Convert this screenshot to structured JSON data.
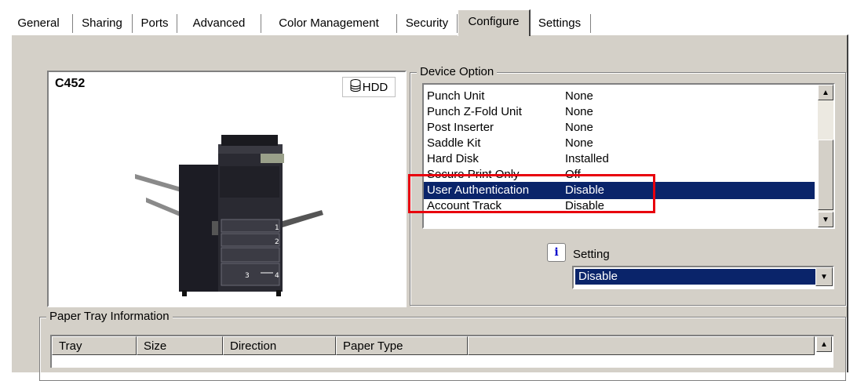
{
  "tabs": [
    {
      "label": "General"
    },
    {
      "label": "Sharing"
    },
    {
      "label": "Ports"
    },
    {
      "label": "Advanced"
    },
    {
      "label": "Color Management"
    },
    {
      "label": "Security"
    },
    {
      "label": "Configure"
    },
    {
      "label": "Settings"
    }
  ],
  "active_tab": "Configure",
  "preview": {
    "model": "C452",
    "hdd_label": "HDD",
    "tray_numbers": [
      "1",
      "2",
      "3",
      "4"
    ]
  },
  "device_option": {
    "title": "Device Option",
    "rows": [
      {
        "name": "Punch Unit",
        "value": "None"
      },
      {
        "name": "Punch Z-Fold Unit",
        "value": "None"
      },
      {
        "name": "Post Inserter",
        "value": "None"
      },
      {
        "name": "Saddle Kit",
        "value": "None"
      },
      {
        "name": "Hard Disk",
        "value": "Installed"
      },
      {
        "name": "Secure Print Only",
        "value": "Off"
      },
      {
        "name": "User Authentication",
        "value": "Disable"
      },
      {
        "name": "Account Track",
        "value": "Disable"
      }
    ],
    "selected_index": 6
  },
  "setting": {
    "label": "Setting",
    "value": "Disable",
    "info_glyph": "i"
  },
  "paper_tray": {
    "title": "Paper Tray Information",
    "columns": [
      "Tray",
      "Size",
      "Direction",
      "Paper Type"
    ]
  },
  "colors": {
    "selection": "#0a246a",
    "highlight_box": "#e8000d",
    "panel": "#d4d0c8"
  }
}
